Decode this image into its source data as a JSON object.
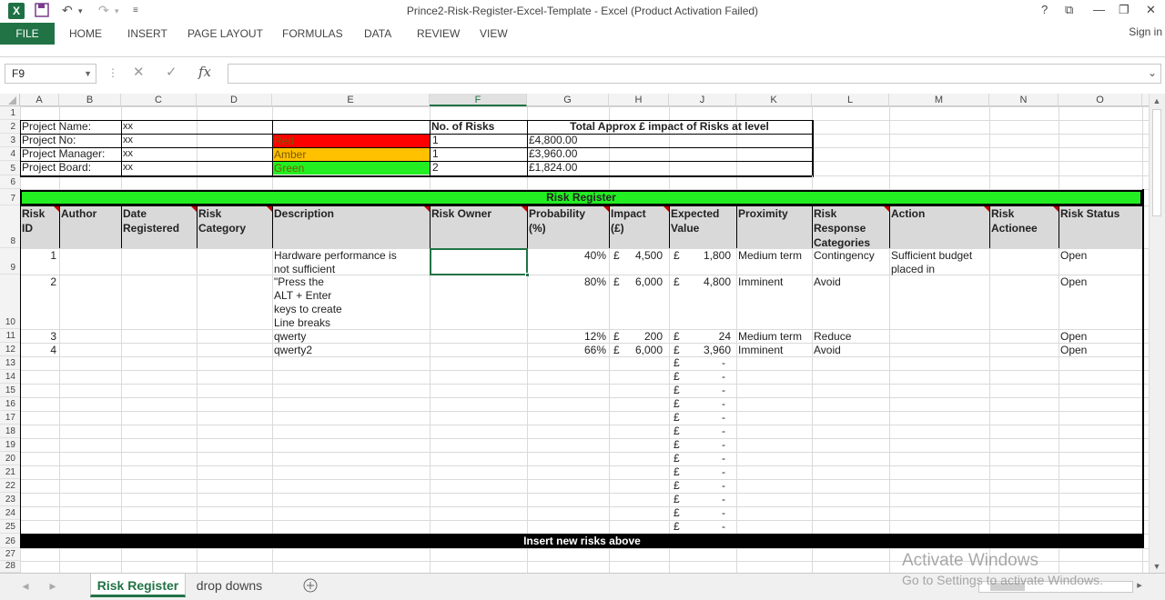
{
  "window": {
    "title": "Prince2-Risk-Register-Excel-Template - Excel (Product Activation Failed)",
    "app_icon": "excel-icon",
    "controls": [
      "?",
      "⧉",
      "—",
      "❐",
      "✕"
    ]
  },
  "ribbon": {
    "file_label": "FILE",
    "tabs": [
      "HOME",
      "INSERT",
      "PAGE LAYOUT",
      "FORMULAS",
      "DATA",
      "REVIEW",
      "VIEW"
    ],
    "sign_in": "Sign in"
  },
  "formula_bar": {
    "name_box": "F9",
    "fx_label": "fx",
    "formula_value": ""
  },
  "columns": [
    "A",
    "B",
    "C",
    "D",
    "E",
    "F",
    "G",
    "H",
    "J",
    "K",
    "L",
    "M",
    "N",
    "O"
  ],
  "selected_column": "F",
  "rows": [
    "1",
    "2",
    "3",
    "4",
    "5",
    "6",
    "7",
    "8",
    "9",
    "10",
    "11",
    "12",
    "13",
    "14",
    "15",
    "16",
    "17",
    "18",
    "19",
    "20",
    "21",
    "22",
    "23",
    "24",
    "25",
    "26",
    "27",
    "28"
  ],
  "summary": {
    "labels": [
      "Project Name:",
      "Project No:",
      "Project Manager:",
      "Project Board:"
    ],
    "values": [
      "xx",
      "xx",
      "xx",
      "xx"
    ],
    "levels": [
      "Red",
      "Amber",
      "Green"
    ],
    "level_colors": [
      "#ff0000",
      "#ffc000",
      "#22ee22"
    ],
    "counts_header": "No. of Risks",
    "counts": [
      "1",
      "1",
      "2"
    ],
    "impact_header": "Total Approx £ impact of Risks at level",
    "impacts": [
      "£4,800.00",
      "£3,960.00",
      "£1,824.00"
    ]
  },
  "register": {
    "title": "Risk Register",
    "header_color": "#22ee22",
    "headers": {
      "risk_id": [
        "Risk",
        "ID"
      ],
      "author": [
        "Author"
      ],
      "date_registered": [
        "Date",
        "Registered"
      ],
      "risk_category": [
        "Risk",
        "Category"
      ],
      "description": [
        "Description"
      ],
      "risk_owner": [
        "Risk Owner"
      ],
      "probability": [
        "Probability",
        "(%)"
      ],
      "impact": [
        "Impact",
        "(£)"
      ],
      "expected_value": [
        "Expected",
        "Value"
      ],
      "proximity": [
        "Proximity"
      ],
      "response": [
        "Risk",
        "Response",
        "Categories"
      ],
      "action": [
        "Action"
      ],
      "actionee": [
        "Risk",
        "Actionee"
      ],
      "status": [
        "Risk Status"
      ]
    },
    "risks": [
      {
        "id": "1",
        "description": [
          "Hardware performance is",
          "not sufficient"
        ],
        "probability": "40%",
        "impact_cur": "£",
        "impact": "4,500",
        "ev_cur": "£",
        "expected_value": "1,800",
        "proximity": "Medium term",
        "response": "Contingency",
        "action": [
          "Sufficient budget",
          "placed in"
        ],
        "status": "Open"
      },
      {
        "id": "2",
        "description": [
          "\"Press the",
          "ALT + Enter",
          "keys to create",
          "Line breaks"
        ],
        "probability": "80%",
        "impact_cur": "£",
        "impact": "6,000",
        "ev_cur": "£",
        "expected_value": "4,800",
        "proximity": "Imminent",
        "response": "Avoid",
        "action": [],
        "status": "Open"
      },
      {
        "id": "3",
        "description": [
          "qwerty"
        ],
        "probability": "12%",
        "impact_cur": "£",
        "impact": "200",
        "ev_cur": "£",
        "expected_value": "24",
        "proximity": "Medium term",
        "response": "Reduce",
        "action": [],
        "status": "Open"
      },
      {
        "id": "4",
        "description": [
          "qwerty2"
        ],
        "probability": "66%",
        "impact_cur": "£",
        "impact": "6,000",
        "ev_cur": "£",
        "expected_value": "3,960",
        "proximity": "Imminent",
        "response": "Avoid",
        "action": [],
        "status": "Open"
      }
    ],
    "empty_ev_cur": "£",
    "empty_ev_value": "-",
    "footer": "Insert new risks above"
  },
  "sheets": [
    "Risk Register",
    "drop downs"
  ],
  "active_sheet": "Risk Register",
  "watermark": [
    "Activate Windows",
    "Go to Settings to activate Windows."
  ]
}
